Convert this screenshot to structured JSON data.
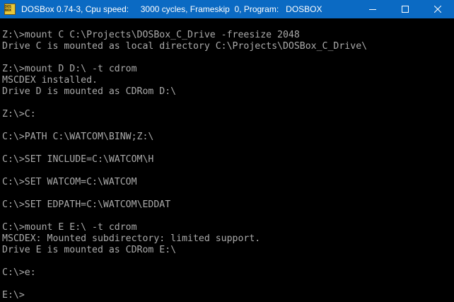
{
  "titlebar": {
    "icon_label": "DOS BOX",
    "title": "DOSBox 0.74-3, Cpu speed:     3000 cycles, Frameskip  0, Program:   DOSBOX"
  },
  "console": {
    "lines": [
      "Z:\\>mount C C:\\Projects\\DOSBox_C_Drive -freesize 2048",
      "Drive C is mounted as local directory C:\\Projects\\DOSBox_C_Drive\\",
      "",
      "Z:\\>mount D D:\\ -t cdrom",
      "MSCDEX installed.",
      "Drive D is mounted as CDRom D:\\",
      "",
      "Z:\\>C:",
      "",
      "C:\\>PATH C:\\WATCOM\\BINW;Z:\\",
      "",
      "C:\\>SET INCLUDE=C:\\WATCOM\\H",
      "",
      "C:\\>SET WATCOM=C:\\WATCOM",
      "",
      "C:\\>SET EDPATH=C:\\WATCOM\\EDDAT",
      "",
      "C:\\>mount E E:\\ -t cdrom",
      "MSCDEX: Mounted subdirectory: limited support.",
      "Drive E is mounted as CDRom E:\\",
      "",
      "C:\\>e:",
      "",
      "E:\\>"
    ]
  }
}
